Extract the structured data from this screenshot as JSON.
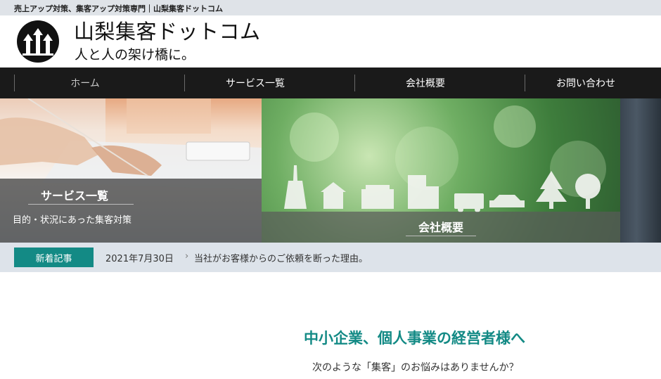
{
  "topbar": {
    "text": "売上アップ対策、集客アップ対策専門｜山梨集客ドットコム"
  },
  "brand": {
    "site_name": "山梨集客ドットコム",
    "tagline": "人と人の架け橋に。",
    "logo_icon": "three-up-arrows-icon"
  },
  "nav": {
    "items": [
      {
        "label": "ホーム",
        "active": true
      },
      {
        "label": "サービス一覧",
        "active": false
      },
      {
        "label": "会社概要",
        "active": false
      },
      {
        "label": "お問い合わせ",
        "active": false
      }
    ]
  },
  "hero": {
    "panels": [
      {
        "title": "サービス一覧",
        "subtitle": "目的・状況にあった集客対策"
      },
      {
        "title": "会社概要"
      }
    ]
  },
  "news": {
    "badge": "新着記事",
    "date": "2021年7月30日",
    "title": "当社がお客様からのご依頼を断った理由。"
  },
  "main": {
    "heading": "中小企業、個人事業の経営者様へ",
    "subheading": "次のような「集客」のお悩みはありませんか？"
  },
  "colors": {
    "accent": "#138a85",
    "nav_bg": "#1a1a1a",
    "topbar_bg": "#dfe3e8",
    "news_bg": "#dde3ea"
  }
}
